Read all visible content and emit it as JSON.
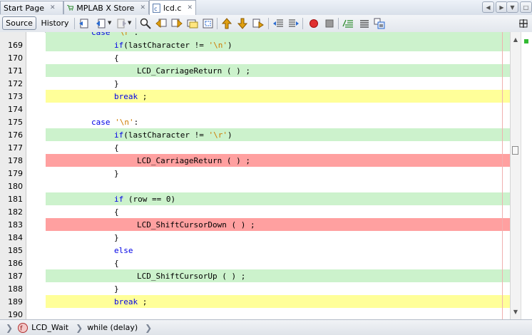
{
  "tabs": [
    {
      "label": "Start Page",
      "icon": "none",
      "active": false
    },
    {
      "label": "MPLAB X Store",
      "icon": "cart-icon",
      "active": false
    },
    {
      "label": "lcd.c",
      "icon": "c-file-icon",
      "active": true
    }
  ],
  "toolbar": {
    "source_label": "Source",
    "history_label": "History"
  },
  "editor": {
    "partial_top": "case '\\r':",
    "lines": [
      {
        "num": "169",
        "code": "if(lastCharacter != '\\n')",
        "indent": 3,
        "hl": "green"
      },
      {
        "num": "170",
        "code": "{",
        "indent": 3,
        "hl": "none"
      },
      {
        "num": "171",
        "code": "LCD_CarriageReturn ( ) ;",
        "indent": 4,
        "hl": "green"
      },
      {
        "num": "172",
        "code": "}",
        "indent": 3,
        "hl": "none"
      },
      {
        "num": "173",
        "code": "break ;",
        "indent": 3,
        "hl": "yellow"
      },
      {
        "num": "174",
        "code": "",
        "indent": 0,
        "hl": "none"
      },
      {
        "num": "175",
        "code": "case '\\n':",
        "indent": 2,
        "hl": "none"
      },
      {
        "num": "176",
        "code": "if(lastCharacter != '\\r')",
        "indent": 3,
        "hl": "green"
      },
      {
        "num": "177",
        "code": "{",
        "indent": 3,
        "hl": "none"
      },
      {
        "num": "178",
        "code": "LCD_CarriageReturn ( ) ;",
        "indent": 4,
        "hl": "red"
      },
      {
        "num": "179",
        "code": "}",
        "indent": 3,
        "hl": "none"
      },
      {
        "num": "180",
        "code": "",
        "indent": 0,
        "hl": "none"
      },
      {
        "num": "181",
        "code": "if (row == 0)",
        "indent": 3,
        "hl": "green"
      },
      {
        "num": "182",
        "code": "{",
        "indent": 3,
        "hl": "none"
      },
      {
        "num": "183",
        "code": "LCD_ShiftCursorDown ( ) ;",
        "indent": 4,
        "hl": "red"
      },
      {
        "num": "184",
        "code": "}",
        "indent": 3,
        "hl": "none"
      },
      {
        "num": "185",
        "code": "else",
        "indent": 3,
        "hl": "none"
      },
      {
        "num": "186",
        "code": "{",
        "indent": 3,
        "hl": "none"
      },
      {
        "num": "187",
        "code": "LCD_ShiftCursorUp ( ) ;",
        "indent": 4,
        "hl": "green"
      },
      {
        "num": "188",
        "code": "}",
        "indent": 3,
        "hl": "none"
      },
      {
        "num": "189",
        "code": "break ;",
        "indent": 3,
        "hl": "yellow"
      },
      {
        "num": "190",
        "code": "",
        "indent": 0,
        "hl": "none"
      }
    ]
  },
  "breadcrumb": [
    {
      "label": "LCD_Wait",
      "icon": "function-icon"
    },
    {
      "label": "while (delay)",
      "icon": "none"
    }
  ],
  "colors": {
    "green_highlight": "#ccf2cc",
    "yellow_highlight": "#ffff99",
    "red_highlight": "#ffa0a0",
    "keyword": "#0000e6",
    "string": "#ce7b00"
  }
}
